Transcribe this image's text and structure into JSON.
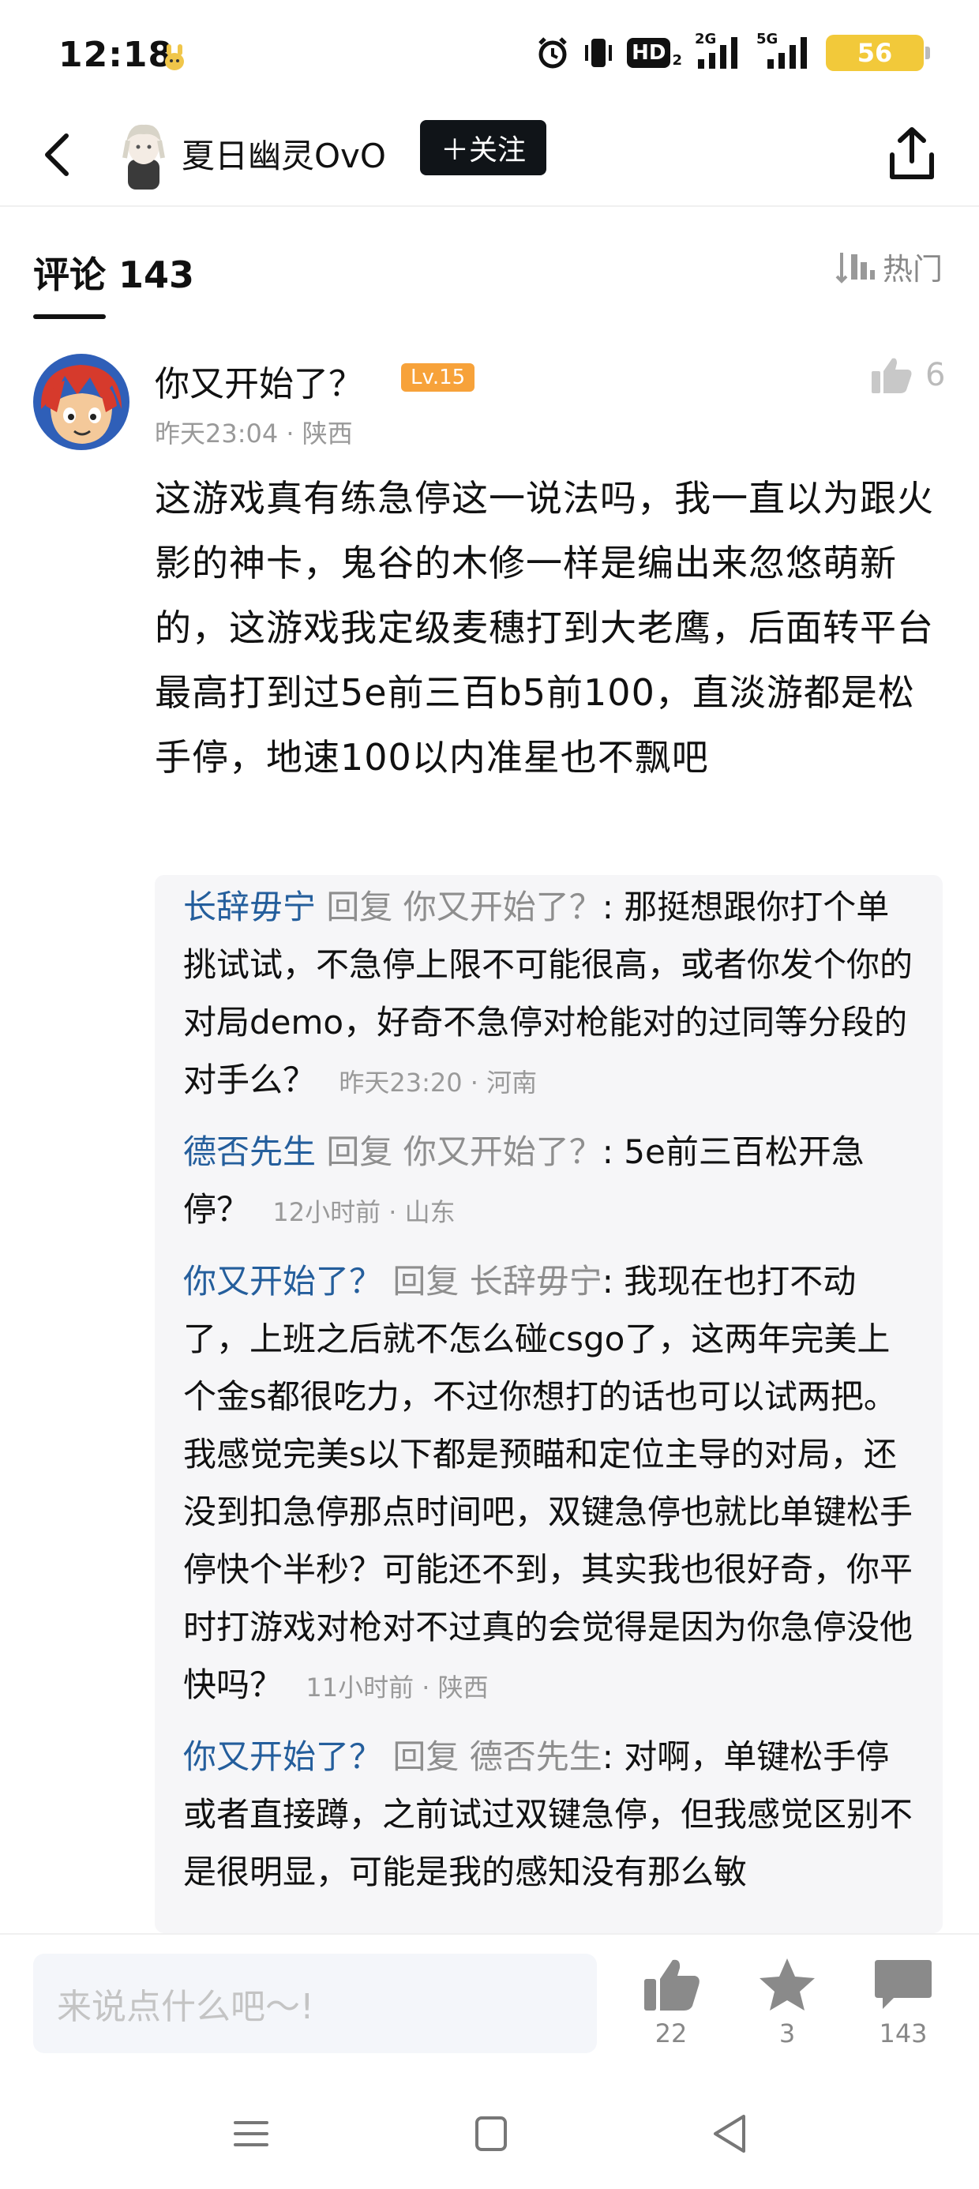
{
  "status_bar": {
    "time": "12:18",
    "hd_label": "HD",
    "hd_sub": "2",
    "net1": "2G",
    "net2": "5G",
    "battery": "56"
  },
  "header": {
    "username": "夏日幽灵OvO",
    "follow_label": "＋关注"
  },
  "comments_bar": {
    "title": "评论 143",
    "sort_label": "热门"
  },
  "comment": {
    "author": "你又开始了？",
    "level": "Lv.15",
    "meta": "昨天23:04 · 陕西",
    "likes": "6",
    "body": "这游戏真有练急停这一说法吗，我一直以为跟火影的神卡，鬼谷的木修一样是编出来忽悠萌新的，这游戏我定级麦穗打到大老鹰，后面转平台最高打到过5e前三百b5前100，直淡游都是松手停，地速100以内准星也不飘吧"
  },
  "replies": [
    {
      "author": "长辞毋宁",
      "verb": "回复",
      "target": "你又开始了？",
      "text": ": 那挺想跟你打个单挑试试，不急停上限不可能很高，或者你发个你的对局demo，好奇不急停对枪能对的过同等分段的对手么？",
      "time": "昨天23:20 · 河南"
    },
    {
      "author": "德否先生",
      "verb": "回复",
      "target": "你又开始了？",
      "text": ": 5e前三百松开急停？",
      "time": "12小时前 · 山东"
    },
    {
      "author": "你又开始了？",
      "verb": "回复",
      "target": "长辞毋宁",
      "text": ": 我现在也打不动了，上班之后就不怎么碰csgo了，这两年完美上个金s都很吃力，不过你想打的话也可以试两把。我感觉完美s以下都是预瞄和定位主导的对局，还没到扣急停那点时间吧，双键急停也就比单键松手停快个半秒？可能还不到，其实我也很好奇，你平时打游戏对枪对不过真的会觉得是因为你急停没他快吗？",
      "time": "11小时前 · 陕西"
    },
    {
      "author": "你又开始了？",
      "verb": "回复",
      "target": "德否先生",
      "text": ": 对啊，单键松手停或者直接蹲，之前试过双键急停，但我感觉区别不是很明显，可能是我的感知没有那么敏",
      "time": ""
    }
  ],
  "bottom_bar": {
    "input_placeholder": "来说点什么吧～!",
    "like_count": "22",
    "star_count": "3",
    "comment_count": "143"
  },
  "icons": {
    "back": "back-arrow-icon",
    "share": "share-icon",
    "sort": "sort-icon",
    "like": "thumbs-up-icon",
    "star": "star-icon",
    "comment": "comment-icon"
  },
  "colors": {
    "reply_name": "#245e9c",
    "level_badge": "#f7a23a",
    "follow_bg": "#101418",
    "battery": "#f2c93a"
  }
}
